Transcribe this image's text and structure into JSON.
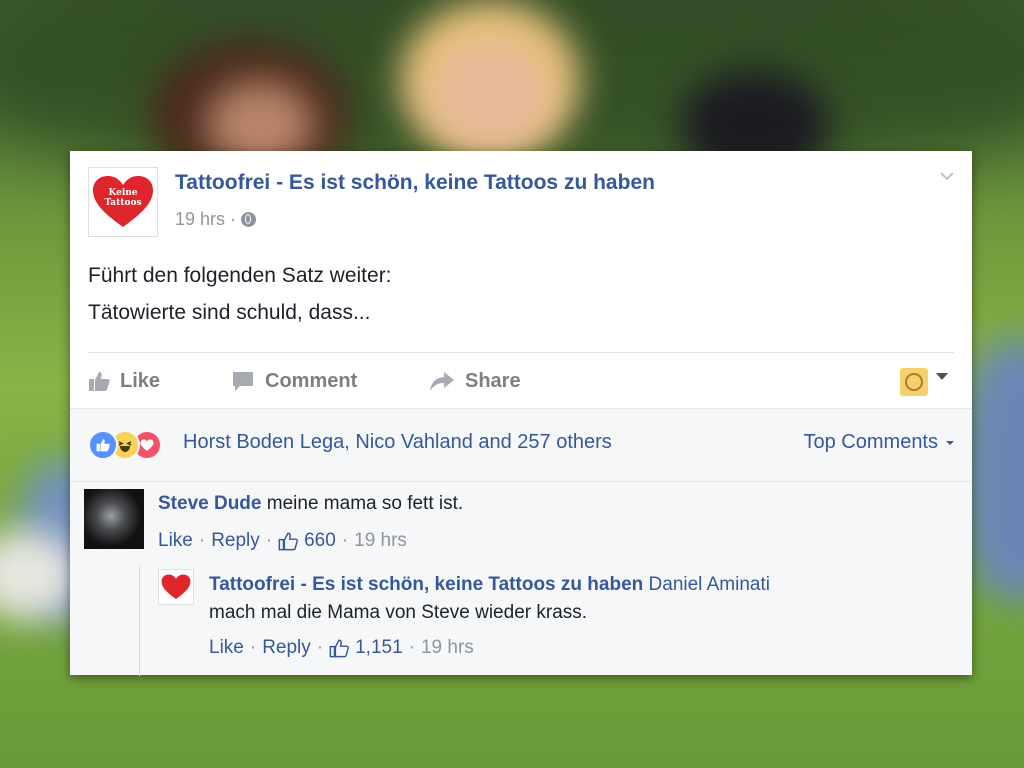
{
  "post": {
    "page_name": "Tattoofrei - Es ist schön, keine Tattoos zu haben",
    "avatar_text_line1": "Keine",
    "avatar_text_line2": "Tattoos",
    "time": "19 hrs",
    "separator": "·",
    "text_line1": "Führt den folgenden Satz weiter:",
    "text_line2": "Tätowierte sind schuld, dass...",
    "actions": {
      "like": "Like",
      "comment": "Comment",
      "share": "Share"
    }
  },
  "feedback": {
    "reactors": "Horst Boden Lega, Nico Vahland and 257 others",
    "sort_label": "Top Comments",
    "reaction_icons": [
      "like-reaction-icon",
      "haha-reaction-icon",
      "love-reaction-icon"
    ]
  },
  "comments": [
    {
      "author": "Steve Dude",
      "text": "meine mama so fett ist.",
      "like_label": "Like",
      "reply_label": "Reply",
      "like_count": "660",
      "time": "19 hrs",
      "separator": "·"
    },
    {
      "author": "Tattoofrei - Es ist schön, keine Tattoos zu haben",
      "mention": "Daniel Aminati",
      "text": "mach mal die Mama von Steve wieder krass.",
      "like_label": "Like",
      "reply_label": "Reply",
      "like_count": "1,151",
      "time": "19 hrs",
      "separator": "·"
    }
  ],
  "colors": {
    "link_blue": "#365899",
    "meta_gray": "#90949c",
    "heart_red": "#e0262d",
    "like_blue": "#5890ff"
  }
}
